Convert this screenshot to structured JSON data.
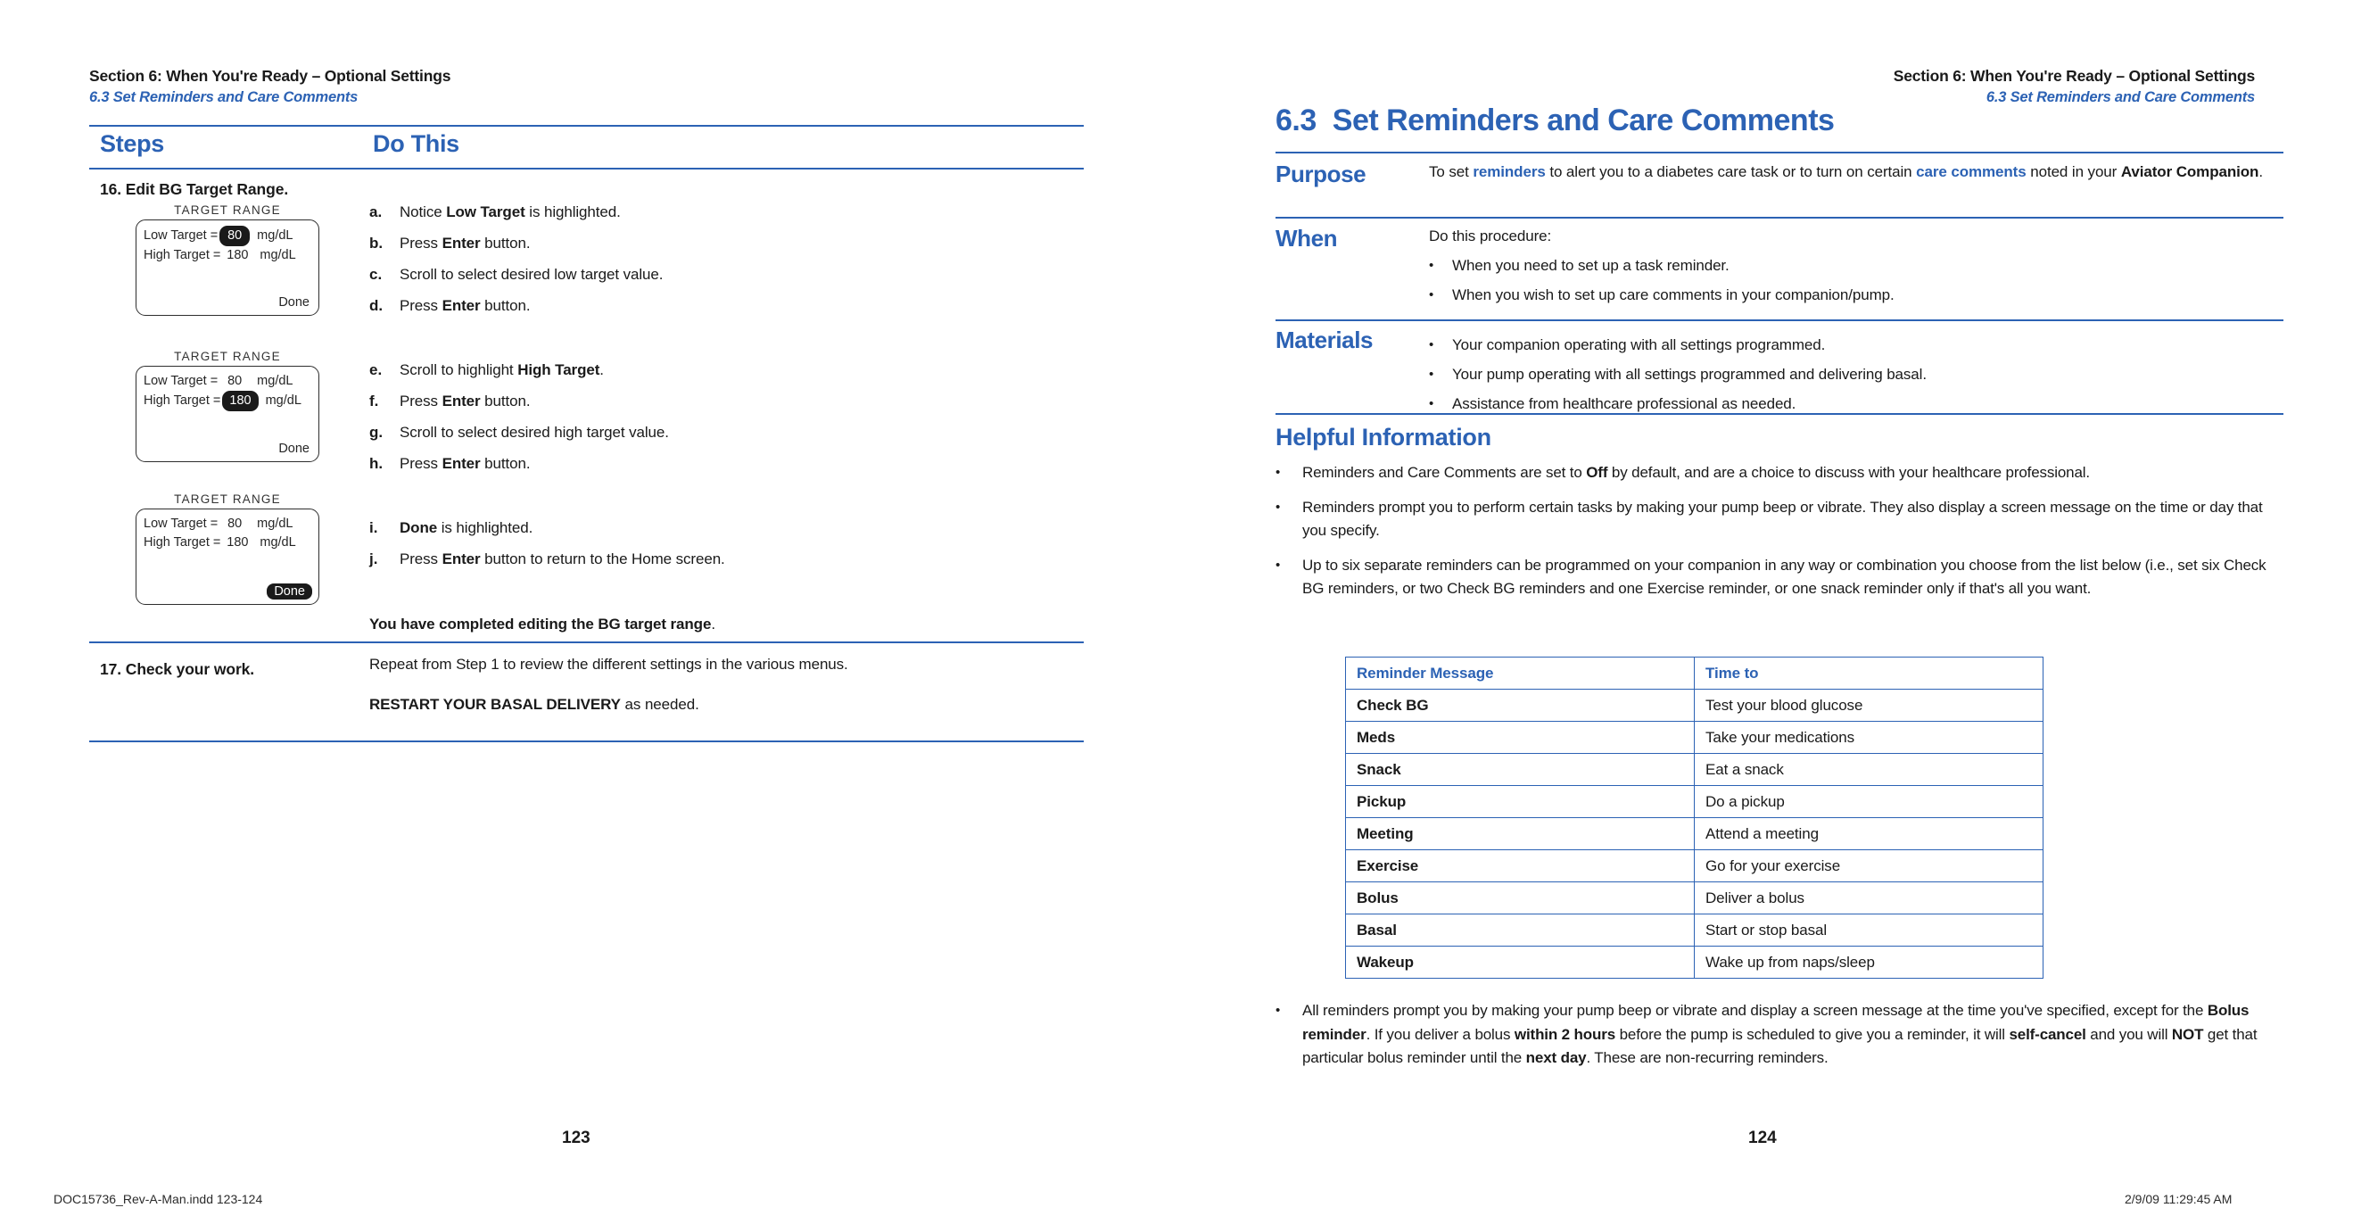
{
  "document": {
    "imprint_left": "DOC15736_Rev-A-Man.indd   123-124",
    "imprint_right": "2/9/09   11:29:45 AM"
  },
  "left_page": {
    "folio": "123",
    "running_head": {
      "line1": "Section 6: When You're Ready – Optional Settings",
      "line2": "6.3 Set Reminders and Care Comments"
    },
    "table": {
      "header_steps": "Steps",
      "header_do_this": "Do This",
      "step16_title": "16. Edit BG Target Range.",
      "devices": [
        {
          "title": "TARGET RANGE",
          "low_label": "Low Target =",
          "low_value": "80",
          "low_unit": "mg/dL",
          "low_highlight": "true",
          "high_label": "High Target =",
          "high_value": "180",
          "high_unit": "mg/dL",
          "high_highlight": "false",
          "done_label": "Done",
          "done_highlight": "false"
        },
        {
          "title": "TARGET RANGE",
          "low_label": "Low Target =",
          "low_value": "80",
          "low_unit": "mg/dL",
          "low_highlight": "false",
          "high_label": "High Target =",
          "high_value": "180",
          "high_unit": "mg/dL",
          "high_highlight": "true",
          "done_label": "Done",
          "done_highlight": "false"
        },
        {
          "title": "TARGET RANGE",
          "low_label": "Low Target =",
          "low_value": "80",
          "low_unit": "mg/dL",
          "low_highlight": "false",
          "high_label": "High Target =",
          "high_value": "180",
          "high_unit": "mg/dL",
          "high_highlight": "false",
          "done_label": "Done",
          "done_highlight": "true"
        }
      ],
      "instructions_group1": [
        {
          "marker": "a.",
          "text_html": "Notice <b>Low Target</b> is highlighted."
        },
        {
          "marker": "b.",
          "text_html": "Press <b>Enter</b> button."
        },
        {
          "marker": "c.",
          "text_html": "Scroll to select desired low target value."
        },
        {
          "marker": "d.",
          "text_html": "Press <b>Enter</b> button."
        }
      ],
      "instructions_group2": [
        {
          "marker": "e.",
          "text_html": "Scroll to highlight <b>High Target</b>."
        },
        {
          "marker": "f.",
          "text_html": "Press <b>Enter</b> button."
        },
        {
          "marker": "g.",
          "text_html": "Scroll to select desired high target value."
        },
        {
          "marker": "h.",
          "text_html": "Press <b>Enter</b> button."
        }
      ],
      "instructions_group3": [
        {
          "marker": "i.",
          "text_html": "<b>Done</b> is highlighted."
        },
        {
          "marker": "j.",
          "text_html": "Press <b>Enter</b> button to return to the Home screen."
        }
      ],
      "completion_note_html": "<b>You have completed editing the BG target range</b>.",
      "step17_title": "17. Check your work.",
      "step17_line1": "Repeat from Step 1 to review the different settings in the various menus.",
      "step17_line2_html": "<b>RESTART YOUR BASAL DELIVERY</b> as needed."
    }
  },
  "right_page": {
    "folio": "124",
    "running_head": {
      "line1": "Section 6: When You're Ready – Optional Settings",
      "line2": "6.3 Set Reminders and Care Comments"
    },
    "section_number": "6.3",
    "section_title": "Set Reminders and Care Comments",
    "purpose": {
      "label": "Purpose",
      "text_html": "To set <span class=\"blue\">reminders</span> to alert you to a diabetes care task or to turn on certain <span class=\"blue\">care comments</span> noted in your <b>Aviator Companion</b>."
    },
    "when": {
      "label": "When",
      "intro": "Do this procedure:",
      "bullets": [
        "When you need to set up a task reminder.",
        "When you wish to set up care comments in your companion/pump."
      ]
    },
    "materials": {
      "label": "Materials",
      "bullets": [
        "Your companion operating with all settings programmed.",
        "Your pump operating with all settings programmed and delivering basal.",
        "Assistance from healthcare professional as needed."
      ]
    },
    "helpful": {
      "title": "Helpful Information",
      "bullets_html": [
        "Reminders and Care Comments are set to <b>Off</b> by default, and are a choice to discuss with your healthcare professional.",
        "Reminders prompt you to perform certain tasks by making your pump beep or vibrate. They also display a screen message on the time or day that you specify.",
        "Up to six separate reminders can be programmed on your companion in any way or combination you choose from the list below (i.e., set six Check BG reminders, or two Check BG reminders and one Exercise reminder, or one snack reminder only if that's all you want."
      ],
      "final_bullet_html": "All reminders prompt you by making your pump beep or vibrate and display a screen message at the time you've specified, except for the <b>Bolus reminder</b>. If you deliver a bolus <b>within 2 hours</b> before the pump is scheduled to give you a reminder, it will <b>self-cancel</b> and you will <b>NOT</b> get that particular bolus reminder until the <b>next day</b>. These are non-recurring reminders."
    },
    "reminder_table": {
      "headers": [
        "Reminder Message",
        "Time to"
      ],
      "rows": [
        [
          "Check BG",
          "Test your blood glucose"
        ],
        [
          "Meds",
          "Take your medications"
        ],
        [
          "Snack",
          "Eat a snack"
        ],
        [
          "Pickup",
          "Do a pickup"
        ],
        [
          "Meeting",
          "Attend a meeting"
        ],
        [
          "Exercise",
          "Go for your exercise"
        ],
        [
          "Bolus",
          "Deliver a bolus"
        ],
        [
          "Basal",
          "Start or stop basal"
        ],
        [
          "Wakeup",
          "Wake up from naps/sleep"
        ]
      ]
    }
  },
  "colors": {
    "accent_blue": "#2c62b4",
    "text_black": "#1a1a1a"
  }
}
